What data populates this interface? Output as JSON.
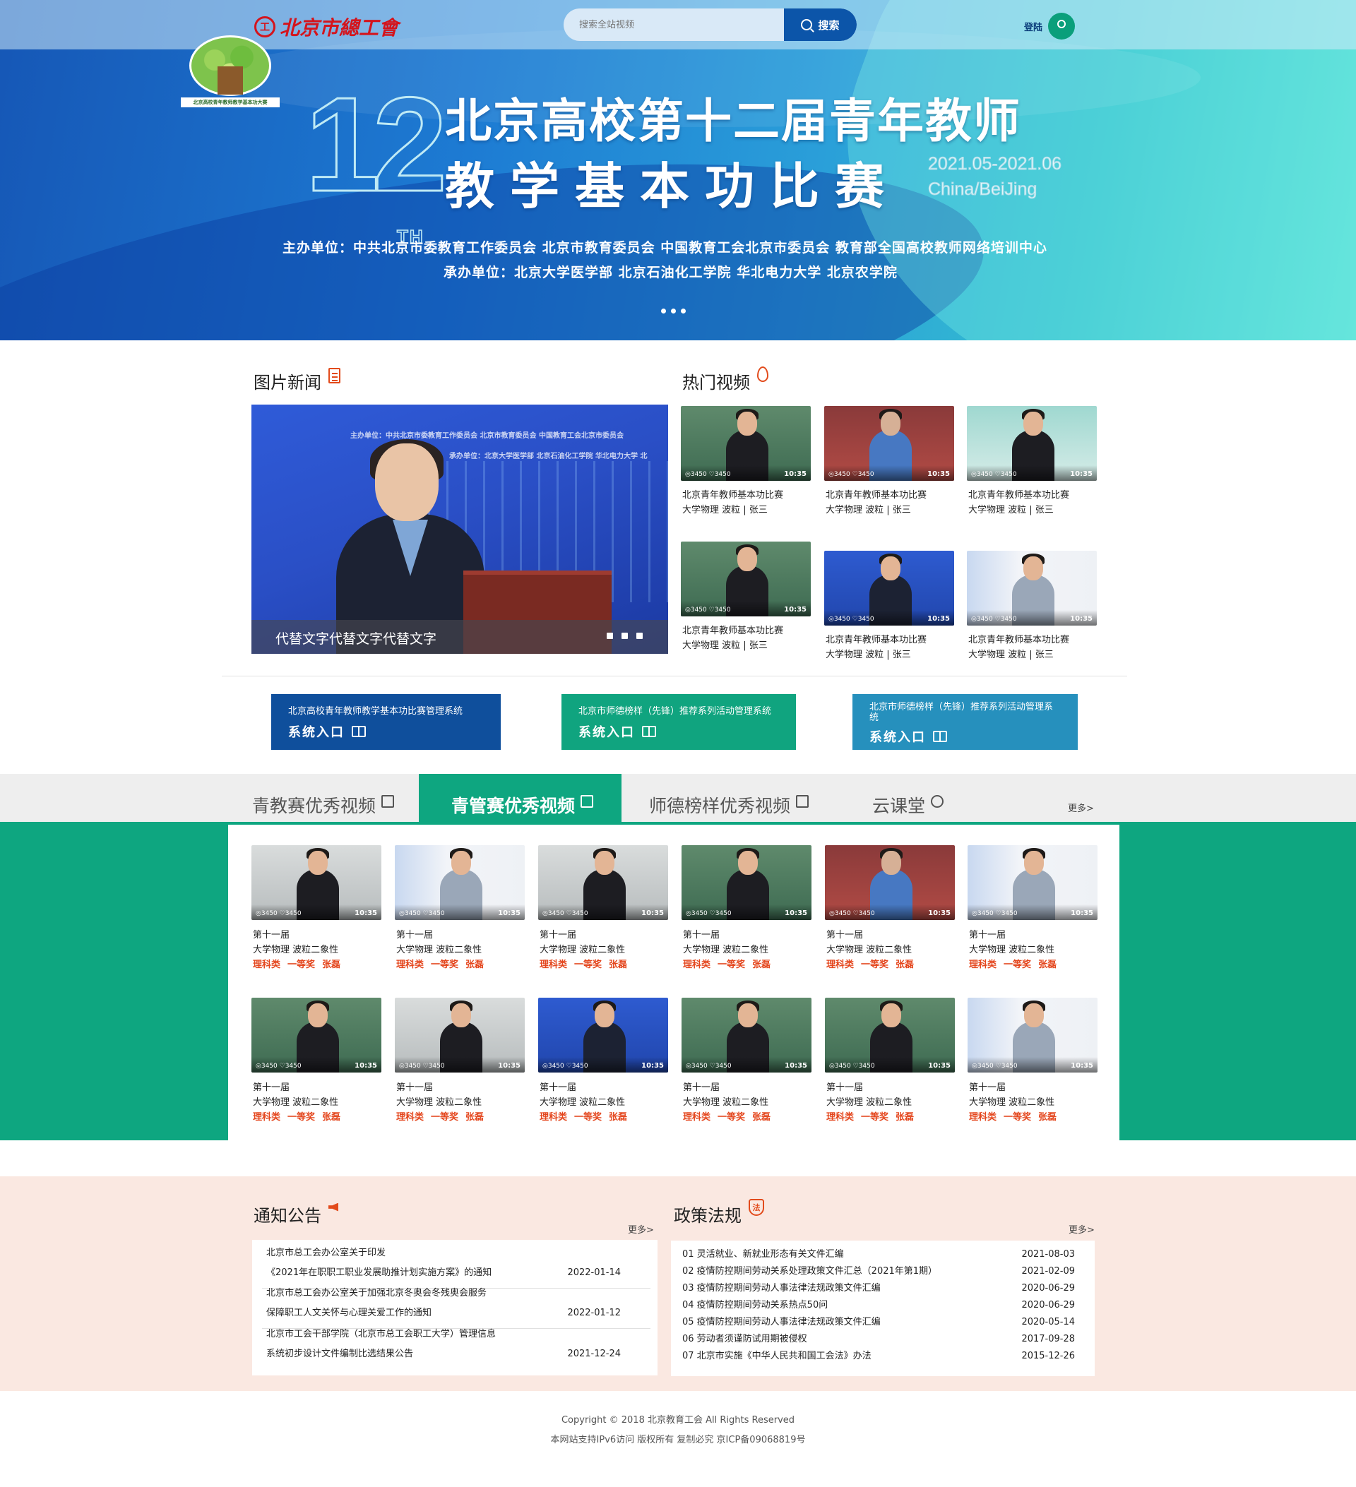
{
  "header": {
    "logo_text": "北京市總工會",
    "search_placeholder": "搜索全站视频",
    "search_button": "搜索",
    "login_label": "登陆"
  },
  "banner": {
    "emblem_caption": "北京高校青年教师教学基本功大赛",
    "edition_numeral": "12",
    "edition_suffix": "TH",
    "title_line1": "北京高校第十二届青年教师",
    "title_line2": "教学基本功比赛",
    "date_range": "2021.05-2021.06",
    "location": "China/BeiJing",
    "organizers": "主办单位：中共北京市委教育工作委员会 北京市教育委员会 中国教育工会北京市委员会 教育部全国高校教师网络培训中心",
    "co_organizers": "承办单位：北京大学医学部 北京石油化工学院 华北电力大学 北京农学院",
    "carousel_pages": 3
  },
  "photo_news": {
    "heading": "图片新闻",
    "caption": "代替文字代替文字代替文字",
    "backdrop_line1": "主办单位：中共北京市委教育工作委员会  北京市教育委员会  中国教育工会北京市委员会",
    "backdrop_line2": "承办单位：北京大学医学部  北京石油化工学院  华北电力大学  北",
    "carousel_pages": 3
  },
  "hot_videos": {
    "heading": "热门视频",
    "items": [
      {
        "views": "3450",
        "likes": "3450",
        "duration": "10:35",
        "title": "北京青年教师基本功比赛",
        "subtitle": "大学物理 波粒 | 张三"
      },
      {
        "views": "3450",
        "likes": "3450",
        "duration": "10:35",
        "title": "北京青年教师基本功比赛",
        "subtitle": "大学物理 波粒 | 张三"
      },
      {
        "views": "3450",
        "likes": "3450",
        "duration": "10:35",
        "title": "北京青年教师基本功比赛",
        "subtitle": "大学物理 波粒 | 张三"
      },
      {
        "views": "3450",
        "likes": "3450",
        "duration": "10:35",
        "title": "北京青年教师基本功比赛",
        "subtitle": "大学物理 波粒 | 张三"
      },
      {
        "views": "3450",
        "likes": "3450",
        "duration": "10:35",
        "title": "北京青年教师基本功比赛",
        "subtitle": "大学物理 波粒 | 张三"
      },
      {
        "views": "3450",
        "likes": "3450",
        "duration": "10:35",
        "title": "北京青年教师基本功比赛",
        "subtitle": "大学物理 波粒 | 张三"
      }
    ]
  },
  "systems": [
    {
      "title": "北京高校青年教师教学基本功比赛管理系统",
      "entry": "系统入口",
      "color": "#0f4f9c"
    },
    {
      "title": "北京市师德榜样（先锋）推荐系列活动管理系统",
      "entry": "系统入口",
      "color": "#10a47f"
    },
    {
      "title": "北京市师德榜样（先锋）推荐系列活动管理系统",
      "entry": "系统入口",
      "color": "#2690bd"
    }
  ],
  "tabs": {
    "items": [
      "青教赛优秀视频",
      "青管赛优秀视频",
      "师德榜样优秀视频",
      "云课堂"
    ],
    "active_index": 1,
    "more": "更多>"
  },
  "featured_videos": {
    "items": [
      {
        "views": "3450",
        "likes": "3450",
        "duration": "10:35",
        "edition": "第十一届",
        "course": "大学物理 波粒二象性",
        "category": "理科类",
        "award": "一等奖",
        "teacher": "张磊"
      },
      {
        "views": "3450",
        "likes": "3450",
        "duration": "10:35",
        "edition": "第十一届",
        "course": "大学物理 波粒二象性",
        "category": "理科类",
        "award": "一等奖",
        "teacher": "张磊"
      },
      {
        "views": "3450",
        "likes": "3450",
        "duration": "10:35",
        "edition": "第十一届",
        "course": "大学物理 波粒二象性",
        "category": "理科类",
        "award": "一等奖",
        "teacher": "张磊"
      },
      {
        "views": "3450",
        "likes": "3450",
        "duration": "10:35",
        "edition": "第十一届",
        "course": "大学物理 波粒二象性",
        "category": "理科类",
        "award": "一等奖",
        "teacher": "张磊"
      },
      {
        "views": "3450",
        "likes": "3450",
        "duration": "10:35",
        "edition": "第十一届",
        "course": "大学物理 波粒二象性",
        "category": "理科类",
        "award": "一等奖",
        "teacher": "张磊"
      },
      {
        "views": "3450",
        "likes": "3450",
        "duration": "10:35",
        "edition": "第十一届",
        "course": "大学物理 波粒二象性",
        "category": "理科类",
        "award": "一等奖",
        "teacher": "张磊"
      },
      {
        "views": "3450",
        "likes": "3450",
        "duration": "10:35",
        "edition": "第十一届",
        "course": "大学物理 波粒二象性",
        "category": "理科类",
        "award": "一等奖",
        "teacher": "张磊"
      },
      {
        "views": "3450",
        "likes": "3450",
        "duration": "10:35",
        "edition": "第十一届",
        "course": "大学物理 波粒二象性",
        "category": "理科类",
        "award": "一等奖",
        "teacher": "张磊"
      },
      {
        "views": "3450",
        "likes": "3450",
        "duration": "10:35",
        "edition": "第十一届",
        "course": "大学物理 波粒二象性",
        "category": "理科类",
        "award": "一等奖",
        "teacher": "张磊"
      },
      {
        "views": "3450",
        "likes": "3450",
        "duration": "10:35",
        "edition": "第十一届",
        "course": "大学物理 波粒二象性",
        "category": "理科类",
        "award": "一等奖",
        "teacher": "张磊"
      },
      {
        "views": "3450",
        "likes": "3450",
        "duration": "10:35",
        "edition": "第十一届",
        "course": "大学物理 波粒二象性",
        "category": "理科类",
        "award": "一等奖",
        "teacher": "张磊"
      },
      {
        "views": "3450",
        "likes": "3450",
        "duration": "10:35",
        "edition": "第十一届",
        "course": "大学物理 波粒二象性",
        "category": "理科类",
        "award": "一等奖",
        "teacher": "张磊"
      }
    ]
  },
  "notices": {
    "heading": "通知公告",
    "more": "更多>",
    "items": [
      {
        "line1": "北京市总工会办公室关于印发",
        "line2": "《2021年在职职工职业发展助推计划实施方案》的通知",
        "date": "2022-01-14"
      },
      {
        "line1": "北京市总工会办公室关于加强北京冬奥会冬残奥会服务",
        "line2": "保障职工人文关怀与心理关爱工作的通知",
        "date": "2022-01-12"
      },
      {
        "line1": "北京市工会干部学院（北京市总工会职工大学）管理信息",
        "line2": "系统初步设计文件编制比选结果公告",
        "date": "2021-12-24"
      }
    ]
  },
  "policies": {
    "heading": "政策法规",
    "badge": "法",
    "more": "更多>",
    "items": [
      {
        "title": "01 灵活就业、新就业形态有关文件汇编",
        "date": "2021-08-03"
      },
      {
        "title": "02 疫情防控期间劳动关系处理政策文件汇总（2021年第1期）",
        "date": "2021-02-09"
      },
      {
        "title": "03 疫情防控期间劳动人事法律法规政策文件汇编",
        "date": "2020-06-29"
      },
      {
        "title": "04 疫情防控期间劳动关系热点50问",
        "date": "2020-06-29"
      },
      {
        "title": "05 疫情防控期间劳动人事法律法规政策文件汇编",
        "date": "2020-05-14"
      },
      {
        "title": "06 劳动者须谨防试用期被侵权",
        "date": "2017-09-28"
      },
      {
        "title": "07 北京市实施《中华人民共和国工会法》办法",
        "date": "2015-12-26"
      }
    ]
  },
  "footer": {
    "copyright": "Copyright © 2018 北京教育工会  All Rights Reserved",
    "icp": "本网站支持IPv6访问 版权所有 复制必究 京ICP备09068819号"
  },
  "colors": {
    "brand_blue": "#0c55a9",
    "brand_green": "#0ea680",
    "accent_red": "#e4461d",
    "logo_red": "#d4141c",
    "notice_bg": "#fae8e1"
  }
}
